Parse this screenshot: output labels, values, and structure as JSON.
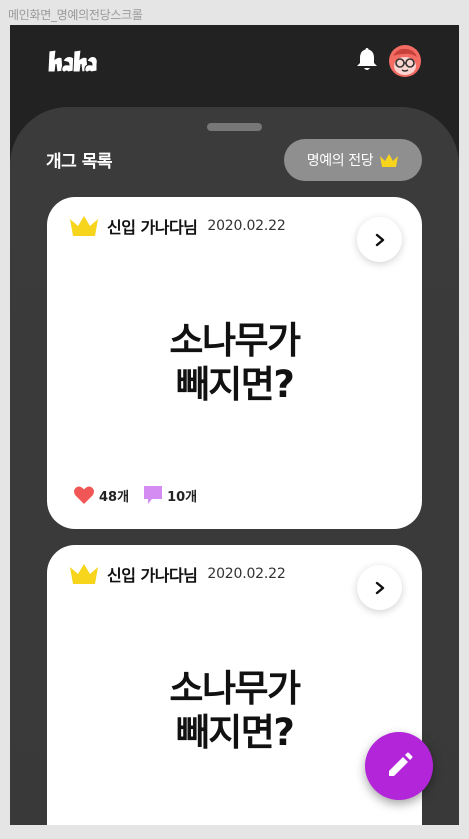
{
  "frame_title": "메인화면_명예의전당스크롤",
  "header": {
    "logo_text": "ha ha",
    "bell_icon": "bell-icon",
    "avatar_icon": "avatar-icon"
  },
  "section": {
    "title": "개그 목록",
    "hall_of_fame_label": "명예의 전당"
  },
  "posts": [
    {
      "author": "신입 가나다님",
      "date": "2020.02.22",
      "line1": "소나무가",
      "line2": "빼지면?",
      "likes": "48개",
      "comments": "10개"
    },
    {
      "author": "신입 가나다님",
      "date": "2020.02.22",
      "line1": "소나무가",
      "line2": "빼지면?"
    }
  ],
  "colors": {
    "background": "#222222",
    "sheet": "#3a3a3a",
    "crown": "#f7d51d",
    "heart": "#f05656",
    "comment": "#d58cf2",
    "fab": "#b325d9"
  }
}
